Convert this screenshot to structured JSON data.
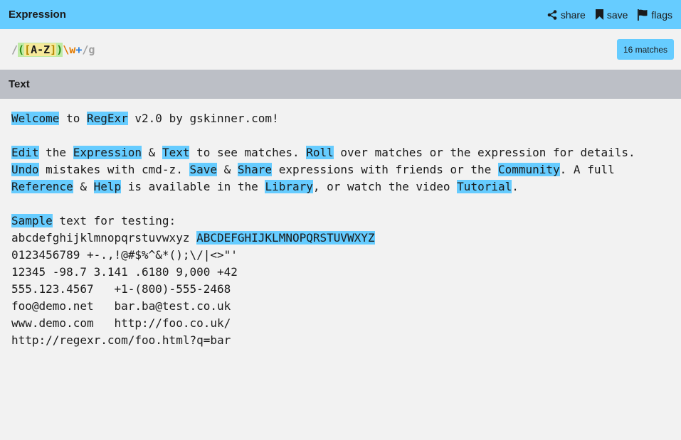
{
  "header": {
    "title": "Expression",
    "share_label": "share",
    "save_label": "save",
    "flags_label": "flags"
  },
  "expression": {
    "open_delim": "/",
    "group_open": "(",
    "set_open": "[",
    "set_content": "A-Z",
    "set_close": "]",
    "group_close": ")",
    "escape": "\\w",
    "quantifier": "+",
    "close_delim": "/",
    "flags": "g"
  },
  "matches_badge": "16 matches",
  "text_section": {
    "title": "Text"
  },
  "text": {
    "line1": [
      {
        "t": "Welcome",
        "m": true
      },
      {
        "t": " to ",
        "m": false
      },
      {
        "t": "RegExr",
        "m": true
      },
      {
        "t": " v2.0 by gskinner.com!",
        "m": false
      }
    ],
    "line2": [],
    "line3": [
      {
        "t": "Edit",
        "m": true
      },
      {
        "t": " the ",
        "m": false
      },
      {
        "t": "Expression",
        "m": true
      },
      {
        "t": " & ",
        "m": false
      },
      {
        "t": "Text",
        "m": true
      },
      {
        "t": " to see matches. ",
        "m": false
      },
      {
        "t": "Roll",
        "m": true
      },
      {
        "t": " over matches or the expression for details.",
        "m": false
      }
    ],
    "line4": [
      {
        "t": "Undo",
        "m": true
      },
      {
        "t": " mistakes with cmd-z. ",
        "m": false
      },
      {
        "t": "Save",
        "m": true
      },
      {
        "t": " & ",
        "m": false
      },
      {
        "t": "Share",
        "m": true
      },
      {
        "t": " expressions with friends or the ",
        "m": false
      },
      {
        "t": "Community",
        "m": true
      },
      {
        "t": ". A full",
        "m": false
      }
    ],
    "line5": [
      {
        "t": "Reference",
        "m": true
      },
      {
        "t": " & ",
        "m": false
      },
      {
        "t": "Help",
        "m": true
      },
      {
        "t": " is available in the ",
        "m": false
      },
      {
        "t": "Library",
        "m": true
      },
      {
        "t": ", or watch the video ",
        "m": false
      },
      {
        "t": "Tutorial",
        "m": true
      },
      {
        "t": ".",
        "m": false
      }
    ],
    "line6": [],
    "line7": [
      {
        "t": "Sample",
        "m": true
      },
      {
        "t": " text for testing:",
        "m": false
      }
    ],
    "line8": [
      {
        "t": "abcdefghijklmnopqrstuvwxyz ",
        "m": false
      },
      {
        "t": "ABCDEFGHIJKLMNOPQRSTUVWXYZ",
        "m": true
      }
    ],
    "line9": [
      {
        "t": "0123456789 +-.,!@#$%^&*();\\/|<>\"'",
        "m": false
      }
    ],
    "line10": [
      {
        "t": "12345 -98.7 3.141 .6180 9,000 +42",
        "m": false
      }
    ],
    "line11": [
      {
        "t": "555.123.4567   +1-(800)-555-2468",
        "m": false
      }
    ],
    "line12": [
      {
        "t": "foo@demo.net   bar.ba@test.co.uk",
        "m": false
      }
    ],
    "line13": [
      {
        "t": "www.demo.com   http://foo.co.uk/",
        "m": false
      }
    ],
    "line14": [
      {
        "t": "http://regexr.com/foo.html?q=bar",
        "m": false
      }
    ]
  },
  "colors": {
    "header_bg": "#66ccff",
    "match_highlight": "#66ccff",
    "section_bg": "#bcbfc6",
    "page_bg": "#f2f2f2"
  }
}
